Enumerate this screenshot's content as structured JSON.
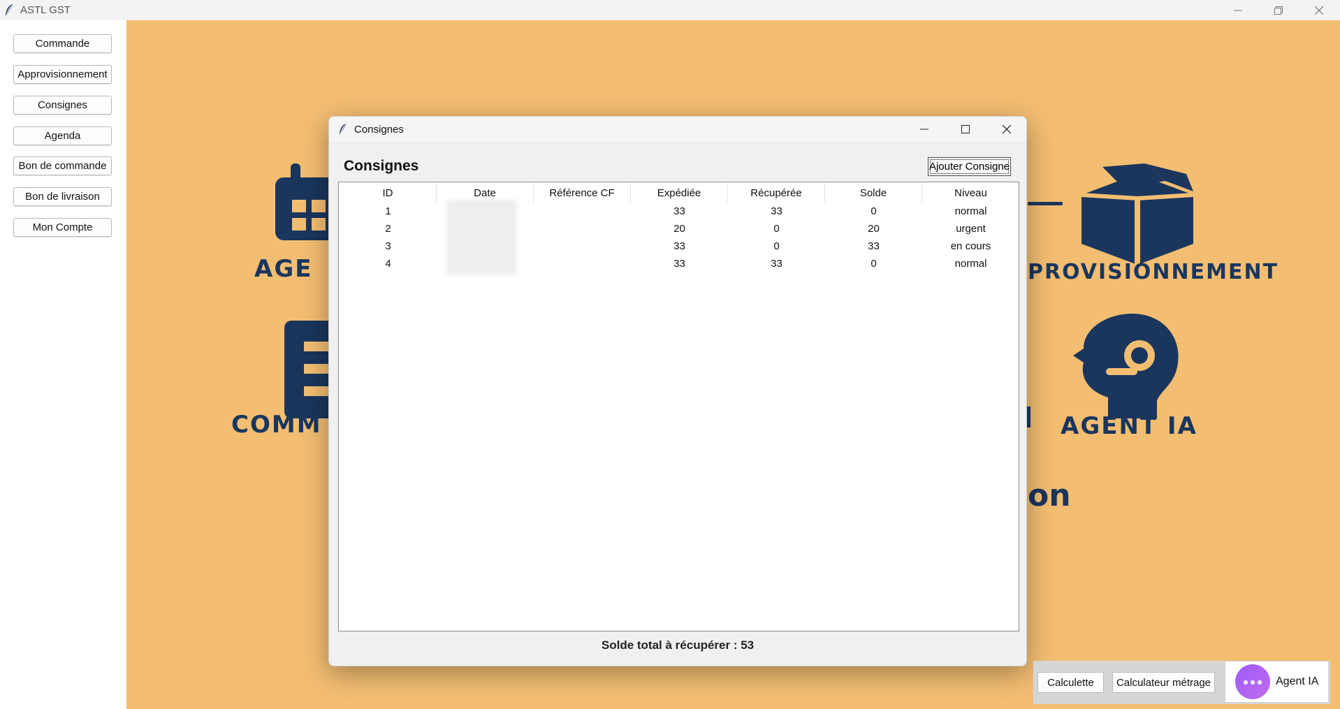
{
  "window": {
    "title": "ASTL GST"
  },
  "sidebar": {
    "items": [
      {
        "label": "Commande"
      },
      {
        "label": "Approvisionnement"
      },
      {
        "label": "Consignes"
      },
      {
        "label": "Agenda"
      },
      {
        "label": "Bon de commande"
      },
      {
        "label": "Bon de livraison"
      },
      {
        "label": "Mon Compte"
      }
    ]
  },
  "background": {
    "labels": [
      "AGE",
      "PROVISIONNEMENT",
      "COMM",
      "AGENT IA",
      "on"
    ],
    "colors": {
      "background": "#f3be72",
      "icons": "#1a365d"
    }
  },
  "dialog": {
    "title": "Consignes",
    "heading": "Consignes",
    "add_button": "Ajouter Consigne",
    "columns": [
      "ID",
      "Date",
      "Référence CF",
      "Expédiée",
      "Récupérée",
      "Solde",
      "Niveau"
    ],
    "rows": [
      {
        "id": "1",
        "date": "",
        "ref": "",
        "expediee": "33",
        "recuperee": "33",
        "solde": "0",
        "niveau": "normal"
      },
      {
        "id": "2",
        "date": "",
        "ref": "",
        "expediee": "20",
        "recuperee": "0",
        "solde": "20",
        "niveau": "urgent"
      },
      {
        "id": "3",
        "date": "",
        "ref": "",
        "expediee": "33",
        "recuperee": "0",
        "solde": "33",
        "niveau": "en cours"
      },
      {
        "id": "4",
        "date": "",
        "ref": "",
        "expediee": "33",
        "recuperee": "33",
        "solde": "0",
        "niveau": "normal"
      }
    ],
    "total_label": "Solde total à récupérer : 53"
  },
  "tools": {
    "calculette": "Calculette",
    "calculateur": "Calculateur métrage",
    "agent": "Agent IA"
  }
}
